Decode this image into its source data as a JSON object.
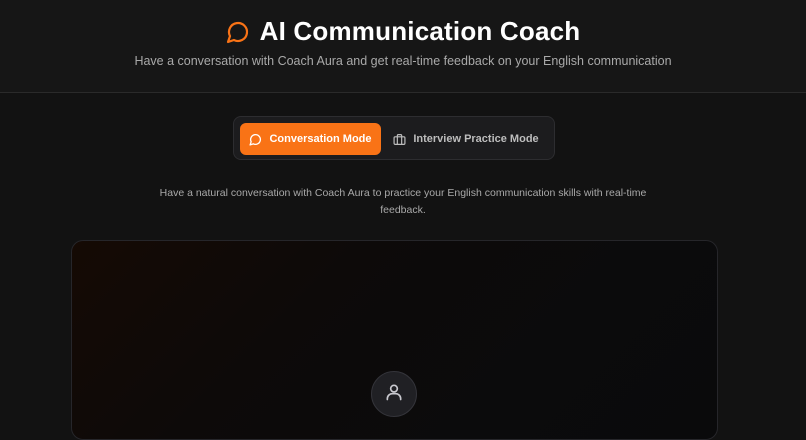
{
  "header": {
    "title": "AI Communication Coach",
    "subtitle": "Have a conversation with Coach Aura and get real-time feedback on your English communication",
    "icon": "chat-bubble-icon",
    "accent_color": "#f97316"
  },
  "modes": {
    "active": {
      "label": "Conversation Mode",
      "icon": "chat-bubble-icon"
    },
    "inactive": {
      "label": "Interview Practice Mode",
      "icon": "briefcase-icon"
    }
  },
  "description": "Have a natural conversation with Coach Aura to practice your English communication skills with real-time feedback.",
  "panel": {
    "avatar_icon": "user-icon"
  }
}
